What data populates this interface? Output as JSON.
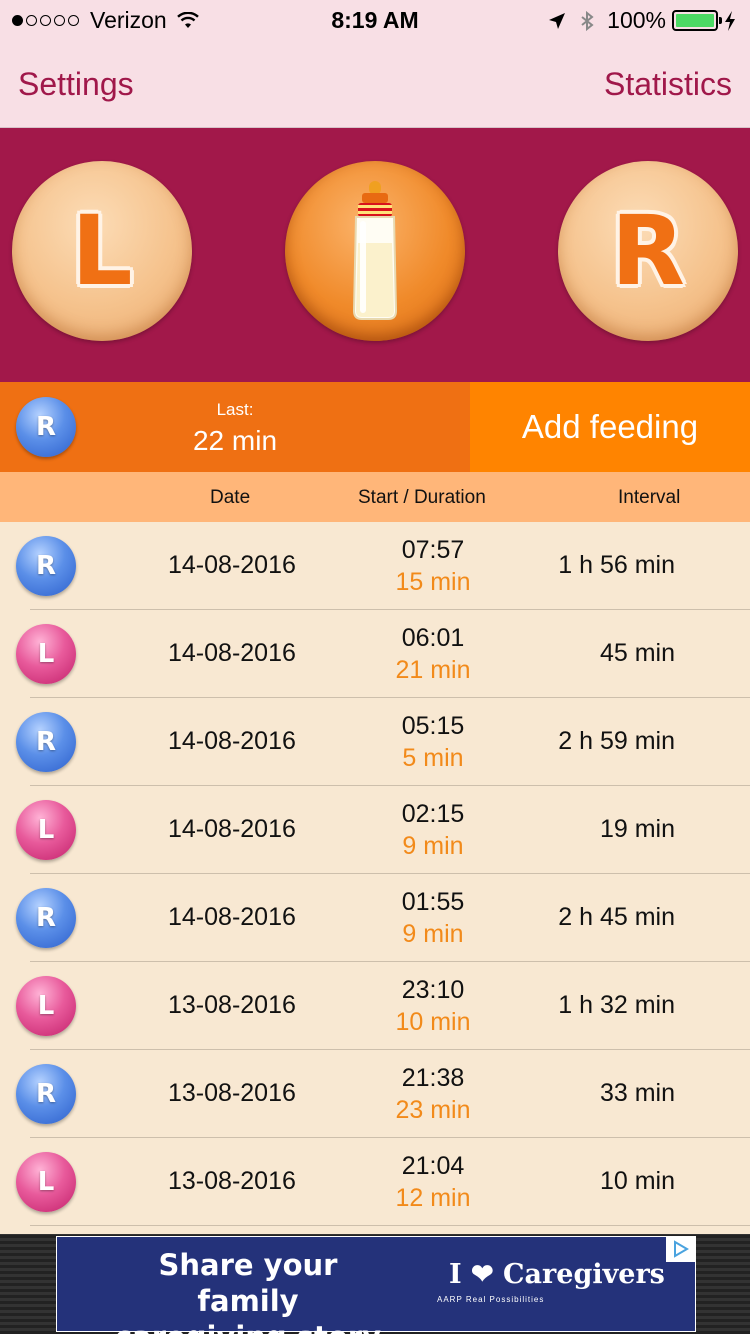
{
  "status_bar": {
    "carrier": "Verizon",
    "time": "8:19 AM",
    "battery": "100%",
    "signal_dots_filled": 1,
    "signal_dots_total": 5
  },
  "nav": {
    "left": "Settings",
    "right": "Statistics"
  },
  "buttons": {
    "left_letter": "L",
    "right_letter": "R"
  },
  "last_feeding": {
    "side": "R",
    "label": "Last:",
    "value": "22 min"
  },
  "add_feeding_label": "Add feeding",
  "columns": {
    "date": "Date",
    "start": "Start / Duration",
    "interval": "Interval"
  },
  "feedings": [
    {
      "side": "R",
      "date": "14-08-2016",
      "start": "07:57",
      "duration": "15 min",
      "interval": "1 h 56 min"
    },
    {
      "side": "L",
      "date": "14-08-2016",
      "start": "06:01",
      "duration": "21 min",
      "interval": "45 min"
    },
    {
      "side": "R",
      "date": "14-08-2016",
      "start": "05:15",
      "duration": "5 min",
      "interval": "2 h 59 min"
    },
    {
      "side": "L",
      "date": "14-08-2016",
      "start": "02:15",
      "duration": "9 min",
      "interval": "19 min"
    },
    {
      "side": "R",
      "date": "14-08-2016",
      "start": "01:55",
      "duration": "9 min",
      "interval": "2 h 45 min"
    },
    {
      "side": "L",
      "date": "13-08-2016",
      "start": "23:10",
      "duration": "10 min",
      "interval": "1 h 32 min"
    },
    {
      "side": "R",
      "date": "13-08-2016",
      "start": "21:38",
      "duration": "23 min",
      "interval": "33 min"
    },
    {
      "side": "L",
      "date": "13-08-2016",
      "start": "21:04",
      "duration": "12 min",
      "interval": "10 min"
    }
  ],
  "ad": {
    "line1": "Share your family",
    "line2": "caregiving story",
    "brand": "I ❤ Caregivers",
    "sub": "AARP Real Possibilities"
  },
  "colors": {
    "nav_background": "#f8dfe5",
    "nav_text": "#a0184a",
    "panel": "#a2184a",
    "last_bar": "#ef7013",
    "add_button": "#ff8400",
    "header": "#ffb679",
    "row_background": "#f8e8d2",
    "duration_text": "#f28a1a",
    "right_marble": "#5b8fe8",
    "left_marble": "#e85a9b"
  },
  "icons": {
    "left_button": "left-breast-icon",
    "bottle_button": "bottle-icon",
    "right_button": "right-breast-icon",
    "right_side_marker": "right-side-icon",
    "left_side_marker": "left-side-icon"
  }
}
